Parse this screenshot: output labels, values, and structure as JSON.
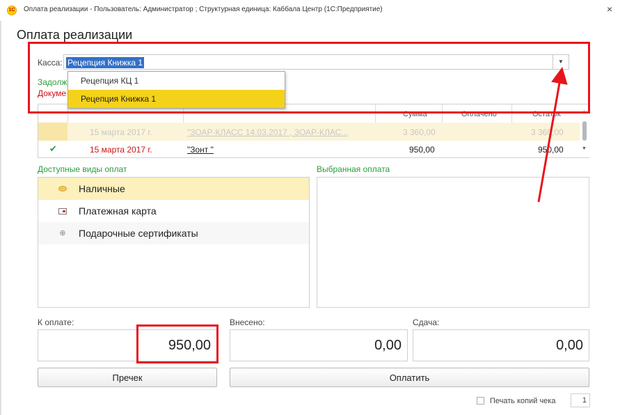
{
  "window": {
    "title": "Оплата реализации - Пользователь: Администратор ; Структурная единица: Каббала Центр  (1С:Предприятие)",
    "close_glyph": "×",
    "logo_text": "1C"
  },
  "form": {
    "title": "Оплата реализации"
  },
  "kassa": {
    "label": "Касса:",
    "value": "Рецепция Книжка 1",
    "options": [
      "Рецепция КЦ 1",
      "Рецепция Книжка 1"
    ],
    "selected_index": 1
  },
  "hidden_labels": {
    "debt": "Задолж",
    "docs": "Докуме"
  },
  "table": {
    "columns": [
      "Сумма",
      "Оплачено",
      "Остаток"
    ],
    "rows": [
      {
        "checked": false,
        "date": "15 марта 2017 г.",
        "document": "\"ЗОАР-КЛАСС 14.03.2017 , ЗОАР-КЛАС...",
        "sum": "3 360,00",
        "paid": "",
        "rest": "3 360,00"
      },
      {
        "checked": true,
        "date": "15 марта 2017 г.",
        "document": "\"Зонт \"",
        "sum": "950,00",
        "paid": "",
        "rest": "950,00"
      }
    ]
  },
  "payments": {
    "available_label": "Доступные виды оплат",
    "chosen_label": "Выбранная оплата",
    "types": [
      {
        "label": "Наличные",
        "icon": "coin-icon"
      },
      {
        "label": "Платежная карта",
        "icon": "card-icon"
      },
      {
        "label": "Подарочные сертификаты",
        "icon": "plus-icon"
      }
    ]
  },
  "amounts": {
    "due_label": "К оплате:",
    "due_value": "950,00",
    "paid_label": "Внесено:",
    "paid_value": "0,00",
    "change_label": "Сдача:",
    "change_value": "0,00"
  },
  "buttons": {
    "precheck": "Пречек",
    "pay": "Оплатить"
  },
  "print": {
    "label": "Печать копий чека",
    "copies": "1",
    "checked": false
  },
  "colors": {
    "accent_yellow": "#f5d21a",
    "highlight_red": "#e8141c",
    "green_label": "#2a9d3a",
    "red_label": "#cc1111",
    "selection_blue": "#3370c8"
  }
}
